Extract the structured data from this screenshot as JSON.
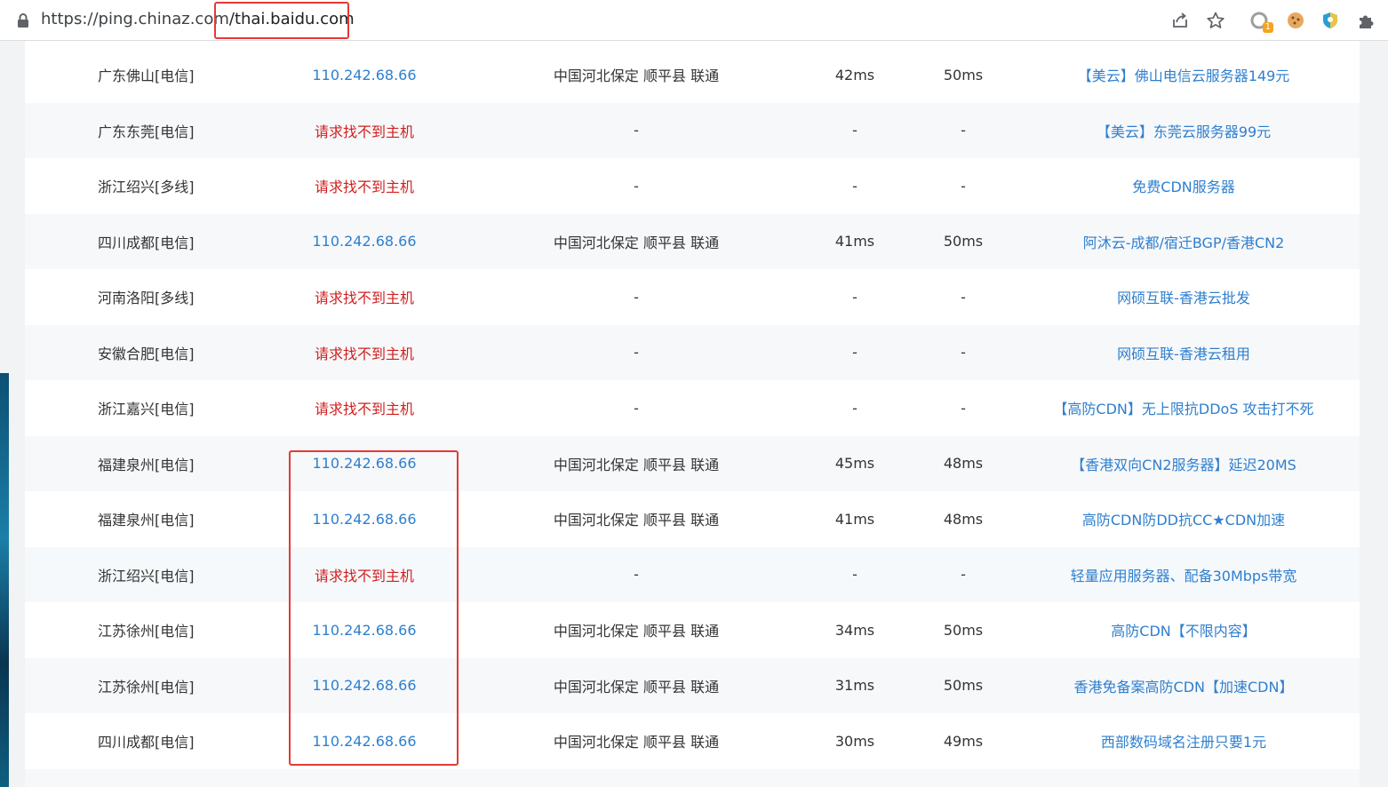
{
  "browser": {
    "url_host": "https://ping.chinaz.com",
    "url_path": "/thai.baidu.com",
    "extension_badge": "1",
    "icons": [
      "lock-icon",
      "share-icon",
      "star-icon",
      "extension-ping-icon",
      "cookie-icon",
      "shield-extension-icon",
      "puzzle-icon"
    ]
  },
  "table": {
    "rows": [
      {
        "location": "广东佛山[电信]",
        "ip": "110.242.68.66",
        "status": "ok",
        "geo": "中国河北保定 顺平县 联通",
        "t1": "42ms",
        "t2": "50ms",
        "ad": "【美云】佛山电信云服务器149元"
      },
      {
        "location": "广东东莞[电信]",
        "ip": "请求找不到主机",
        "status": "err",
        "geo": "-",
        "t1": "-",
        "t2": "-",
        "ad": "【美云】东莞云服务器99元"
      },
      {
        "location": "浙江绍兴[多线]",
        "ip": "请求找不到主机",
        "status": "err",
        "geo": "-",
        "t1": "-",
        "t2": "-",
        "ad": "免费CDN服务器"
      },
      {
        "location": "四川成都[电信]",
        "ip": "110.242.68.66",
        "status": "ok",
        "geo": "中国河北保定 顺平县 联通",
        "t1": "41ms",
        "t2": "50ms",
        "ad": "阿沐云-成都/宿迁BGP/香港CN2"
      },
      {
        "location": "河南洛阳[多线]",
        "ip": "请求找不到主机",
        "status": "err",
        "geo": "-",
        "t1": "-",
        "t2": "-",
        "ad": "网硕互联-香港云批发"
      },
      {
        "location": "安徽合肥[电信]",
        "ip": "请求找不到主机",
        "status": "err",
        "geo": "-",
        "t1": "-",
        "t2": "-",
        "ad": "网硕互联-香港云租用"
      },
      {
        "location": "浙江嘉兴[电信]",
        "ip": "请求找不到主机",
        "status": "err",
        "geo": "-",
        "t1": "-",
        "t2": "-",
        "ad": "【高防CDN】无上限抗DDoS 攻击打不死"
      },
      {
        "location": "福建泉州[电信]",
        "ip": "110.242.68.66",
        "status": "ok",
        "geo": "中国河北保定 顺平县 联通",
        "t1": "45ms",
        "t2": "48ms",
        "ad": "【香港双向CN2服务器】延迟20MS"
      },
      {
        "location": "福建泉州[电信]",
        "ip": "110.242.68.66",
        "status": "ok",
        "geo": "中国河北保定 顺平县 联通",
        "t1": "41ms",
        "t2": "48ms",
        "ad": "高防CDN防DD抗CC★CDN加速"
      },
      {
        "location": "浙江绍兴[电信]",
        "ip": "请求找不到主机",
        "status": "err",
        "geo": "-",
        "t1": "-",
        "t2": "-",
        "ad": "轻量应用服务器、配备30Mbps带宽"
      },
      {
        "location": "江苏徐州[电信]",
        "ip": "110.242.68.66",
        "status": "ok",
        "geo": "中国河北保定 顺平县 联通",
        "t1": "34ms",
        "t2": "50ms",
        "ad": "高防CDN【不限内容】"
      },
      {
        "location": "江苏徐州[电信]",
        "ip": "110.242.68.66",
        "status": "ok",
        "geo": "中国河北保定 顺平县 联通",
        "t1": "31ms",
        "t2": "50ms",
        "ad": "香港免备案高防CDN【加速CDN】"
      },
      {
        "location": "四川成都[电信]",
        "ip": "110.242.68.66",
        "status": "ok",
        "geo": "中国河北保定 顺平县 联通",
        "t1": "30ms",
        "t2": "49ms",
        "ad": "西部数码域名注册只要1元"
      }
    ]
  },
  "colors": {
    "link_blue": "#2e7fce",
    "error_red": "#d01f1f",
    "highlight_red": "#e53935"
  }
}
